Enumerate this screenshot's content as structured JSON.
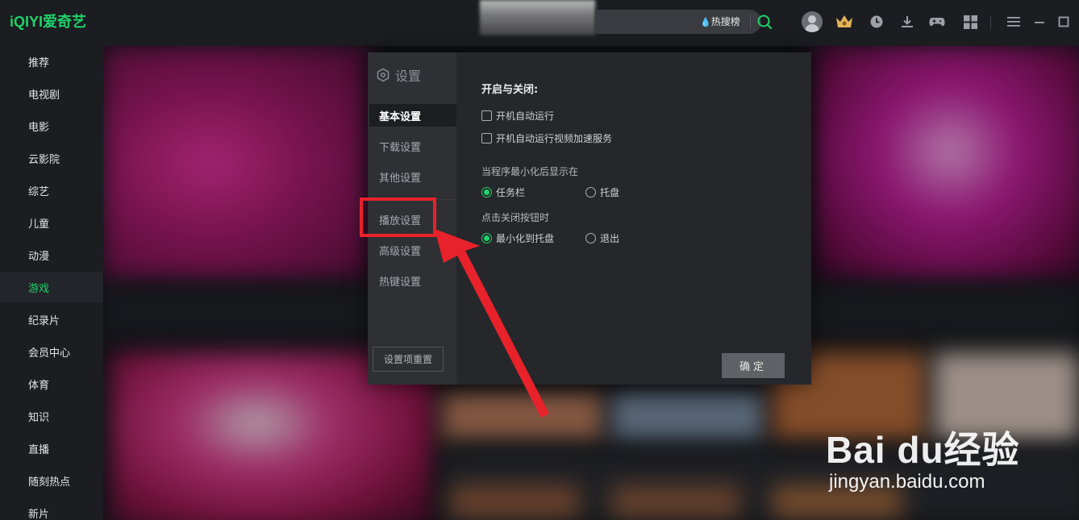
{
  "app": {
    "logo": "iQIYI爱奇艺"
  },
  "sidebar": {
    "items": [
      {
        "label": "推荐"
      },
      {
        "label": "电视剧"
      },
      {
        "label": "电影"
      },
      {
        "label": "云影院"
      },
      {
        "label": "综艺"
      },
      {
        "label": "儿童"
      },
      {
        "label": "动漫"
      },
      {
        "label": "游戏",
        "active": true
      },
      {
        "label": "纪录片"
      },
      {
        "label": "会员中心"
      },
      {
        "label": "体育"
      },
      {
        "label": "知识"
      },
      {
        "label": "直播"
      },
      {
        "label": "随刻热点"
      },
      {
        "label": "新片"
      }
    ]
  },
  "topbar": {
    "hot_search_label": "热搜榜",
    "icons": [
      "avatar",
      "vip-crown-icon",
      "history-icon",
      "download-icon",
      "game-icon",
      "apps-icon",
      "menu-icon",
      "minimize-icon",
      "maximize-icon"
    ]
  },
  "settings": {
    "title": "设置",
    "menu": [
      "基本设置",
      "下载设置",
      "其他设置",
      "播放设置",
      "高级设置",
      "热键设置"
    ],
    "active_menu": "基本设置",
    "reset_label": "设置项重置",
    "section_title": "开启与关闭:",
    "checkboxes": [
      {
        "label": "开机自动运行",
        "checked": false
      },
      {
        "label": "开机自动运行视频加速服务",
        "checked": false
      }
    ],
    "minimize_label": "当程序最小化后显示在",
    "minimize_options": [
      {
        "label": "任务栏",
        "selected": true
      },
      {
        "label": "托盘",
        "selected": false
      }
    ],
    "close_label": "点击关闭按钮时",
    "close_options": [
      {
        "label": "最小化到托盘",
        "selected": true
      },
      {
        "label": "退出",
        "selected": false
      }
    ],
    "ok_label": "确定"
  },
  "colors": {
    "accent": "#1fd26a",
    "annotation": "#e8222a"
  },
  "watermark": {
    "brand": "Bai du经验",
    "url": "jingyan.baidu.com"
  }
}
